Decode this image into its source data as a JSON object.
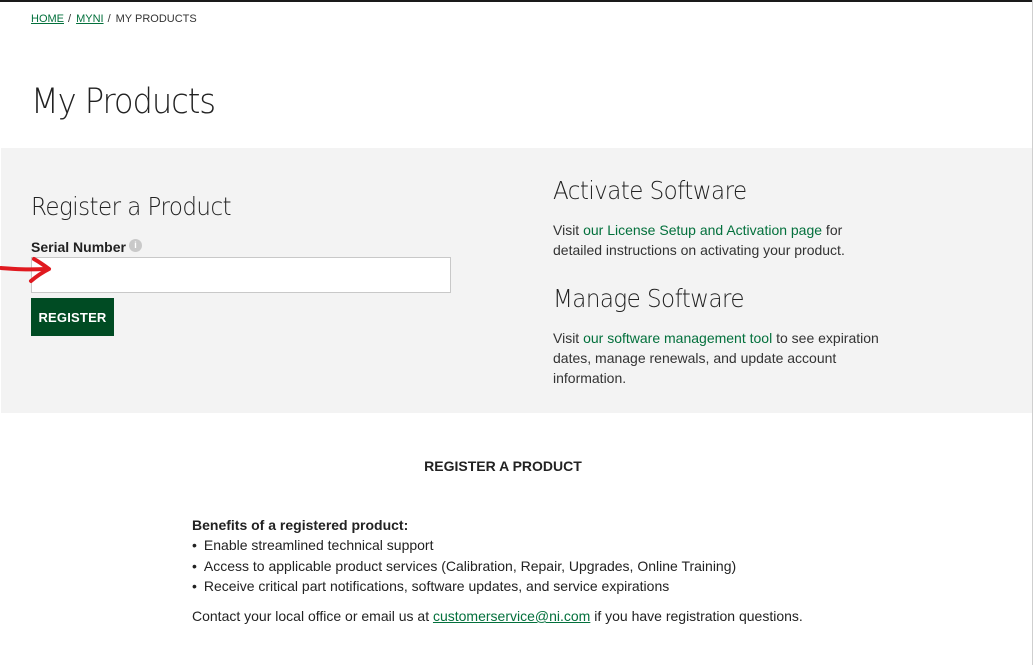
{
  "breadcrumb": {
    "home": "HOME",
    "myni": "MYNI",
    "current": "MY PRODUCTS",
    "separator": "/"
  },
  "page": {
    "title": "My Products"
  },
  "register": {
    "heading": "Register a Product",
    "serial_label": "Serial Number",
    "serial_value": "",
    "button_label": "REGISTER",
    "info_icon": "info-icon"
  },
  "activate": {
    "heading": "Activate Software",
    "text_before": "Visit ",
    "link_text": "our License Setup and Activation page",
    "text_after": " for detailed instructions on activating your product."
  },
  "manage": {
    "heading": "Manage Software",
    "text_before": "Visit ",
    "link_text": "our software management tool",
    "text_after": " to see expiration dates, manage renewals, and update account information."
  },
  "info": {
    "heading": "REGISTER A PRODUCT",
    "benefits_title": "Benefits of a registered product:",
    "benefits": [
      "Enable streamlined technical support",
      "Access to applicable product services (Calibration, Repair, Upgrades, Online Training)",
      "Receive critical part notifications, software updates, and service expirations"
    ],
    "contact_before": "Contact your local office or email us at ",
    "contact_email": "customerservice@ni.com",
    "contact_after": " if you have registration questions."
  },
  "colors": {
    "brand_green": "#004b23",
    "link_green": "#03703c",
    "panel_bg": "#f3f3f3",
    "annotation_red": "#e0191f"
  }
}
